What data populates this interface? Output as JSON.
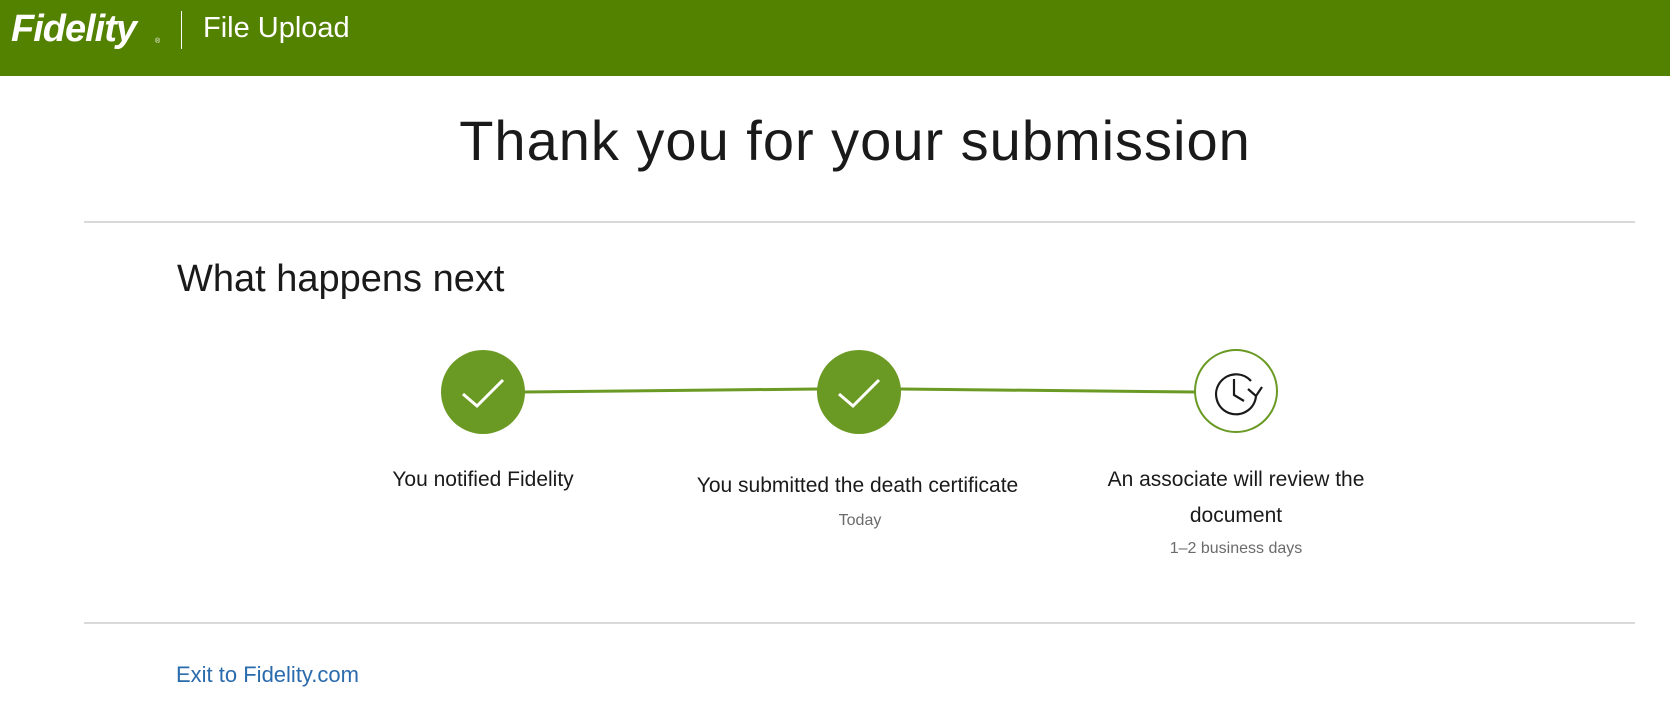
{
  "header": {
    "logo_text": "Fidelity",
    "logo_mark": "®",
    "title": "File Upload",
    "background_color": "#538100"
  },
  "main": {
    "heading": "Thank you for your submission",
    "section_heading": "What happens next"
  },
  "tracker": {
    "accent_color": "#6a9a23",
    "steps": [
      {
        "label": "You notified Fidelity",
        "sublabel": "",
        "status": "complete",
        "icon": "check-icon"
      },
      {
        "label": "You submitted the death certificate",
        "sublabel": "Today",
        "status": "complete",
        "icon": "check-icon"
      },
      {
        "label": "An associate will review the document",
        "sublabel": "1–2 business days",
        "status": "pending",
        "icon": "clock-icon"
      }
    ]
  },
  "footer": {
    "exit_link": "Exit to Fidelity.com",
    "link_color": "#2a6bad"
  }
}
